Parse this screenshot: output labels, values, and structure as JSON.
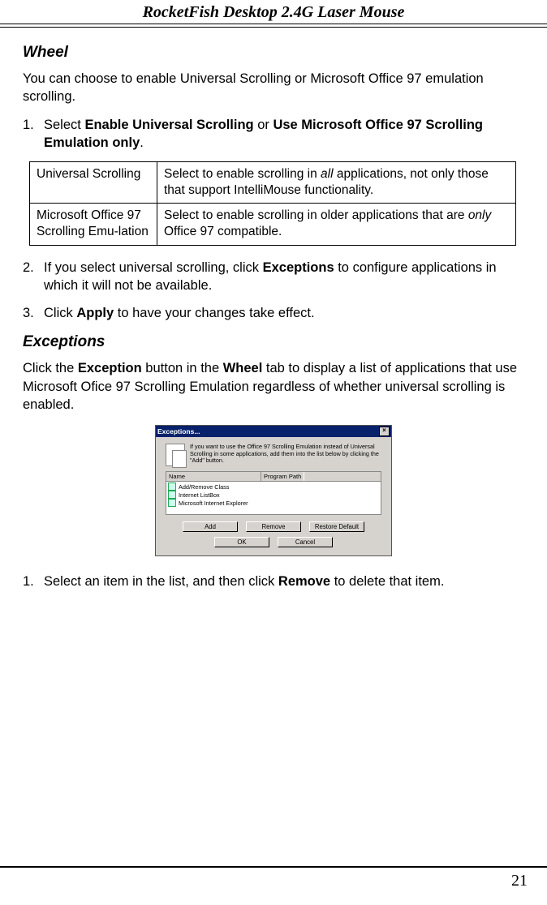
{
  "header": {
    "title": "RocketFish Desktop 2.4G Laser Mouse"
  },
  "wheel": {
    "heading": "Wheel",
    "intro": "You can choose to enable Universal Scrolling or Microsoft Office 97 emulation scrolling.",
    "step1_num": "1.",
    "step1_pre": "Select ",
    "step1_b1": "Enable Universal Scrolling",
    "step1_mid": " or ",
    "step1_b2": "Use Microsoft Office 97 Scrolling Emulation only",
    "step1_end": ".",
    "table": {
      "r1c1": "Universal Scrolling",
      "r1c2_pre": "Select to enable scrolling in ",
      "r1c2_it": "all",
      "r1c2_post": " applications, not only those that support IntelliMouse functionality.",
      "r2c1": "Microsoft Office 97 Scrolling Emu-lation",
      "r2c2_pre": "Select to enable scrolling in older applications that are ",
      "r2c2_it": "only",
      "r2c2_post": " Office 97 compatible."
    },
    "step2_num": "2.",
    "step2_pre": "If you select universal scrolling, click ",
    "step2_b": "Exceptions",
    "step2_post": " to configure applications in which it will not be available.",
    "step3_num": "3.",
    "step3_pre": "Click ",
    "step3_b": "Apply",
    "step3_post": " to have your changes take effect."
  },
  "exceptions": {
    "heading": "Exceptions",
    "intro_pre": "Click the ",
    "intro_b1": "Exception",
    "intro_mid": " button in the ",
    "intro_b2": "Wheel",
    "intro_post": " tab to display a list of applications that use Microsoft Ofice 97 Scrolling Emulation regardless of whether universal scrolling is enabled.",
    "step1_num": "1.",
    "step1_pre": "Select an item in the list, and then click ",
    "step1_b": "Remove",
    "step1_post": " to delete that item."
  },
  "dialog": {
    "title": "Exceptions...",
    "hint": "If you want to use the Office 97 Scrolling Emulation instead of Universal Scrolling in some applications, add them into the list below by clicking the \"Add\" button.",
    "col_name": "Name",
    "col_path": "Program Path",
    "rows": [
      "Add/Remove Class",
      "Internet ListBox",
      "Microsoft Internet Explorer"
    ],
    "btn_add": "Add",
    "btn_remove": "Remove",
    "btn_restore": "Restore Default",
    "btn_ok": "OK",
    "btn_cancel": "Cancel"
  },
  "page_number": "21"
}
